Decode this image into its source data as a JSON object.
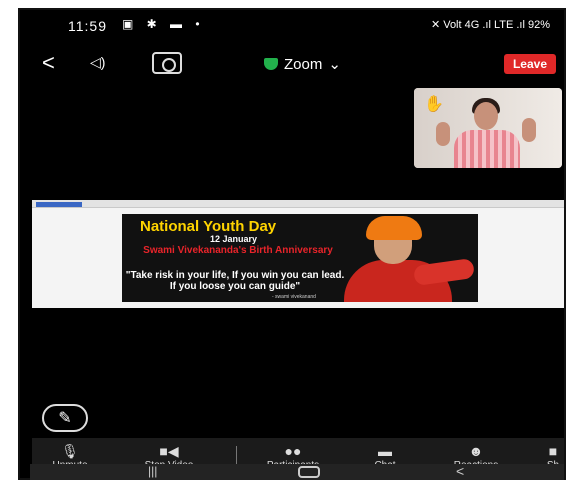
{
  "status": {
    "time": "11:59",
    "left_icons": "▣ ✱ ▬ •",
    "right_icons": "✕ Volt 4G .ıl LTE .ıl 92%"
  },
  "header": {
    "meeting_title": "Zoom",
    "leave_label": "Leave"
  },
  "banner": {
    "headline": "National Youth Day",
    "date": "12 January",
    "birth_line": "Swami Vivekananda's Birth Anniversary",
    "quote": "\"Take risk in your life, If you win you can lead. If you loose you can guide\"",
    "credit": "- swami vivekanand"
  },
  "controls": {
    "unmute": "Unmute",
    "stop_video": "Stop Video",
    "participants": "Participants",
    "chat": "Chat",
    "reactions": "Reactions",
    "share": "Sh"
  },
  "colors": {
    "leave": "#e02828",
    "shield": "#22b14c",
    "headline": "#ffd400",
    "birth": "#e8242a"
  }
}
